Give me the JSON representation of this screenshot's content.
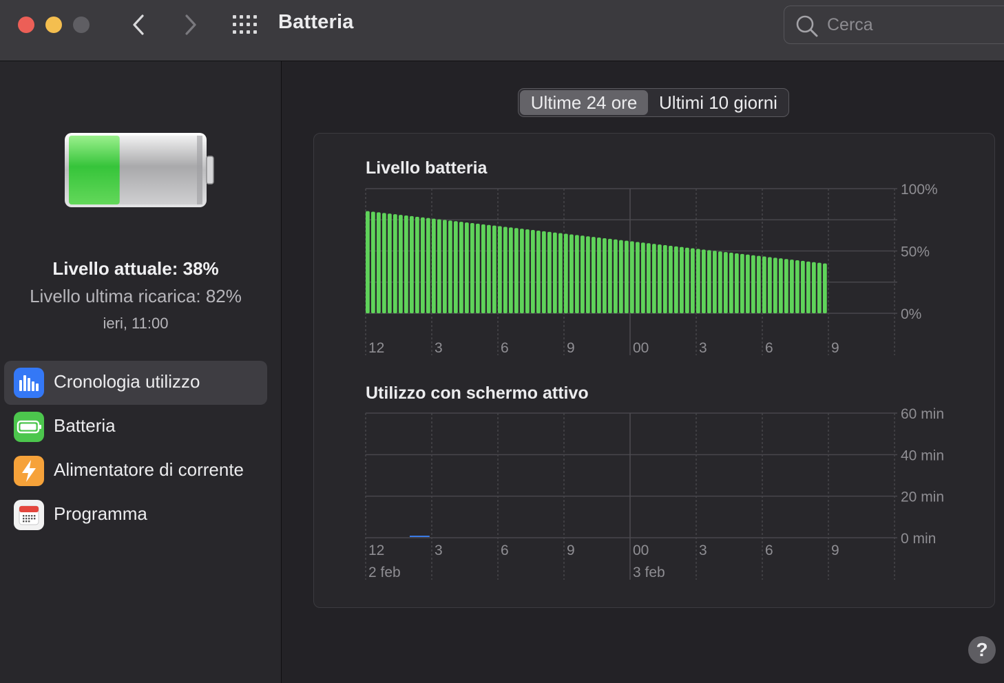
{
  "window": {
    "title": "Batteria",
    "search_placeholder": "Cerca",
    "help_label": "?"
  },
  "sidebar": {
    "current_level": "Livello attuale: 38%",
    "last_charge": "Livello ultima ricarica: 82%",
    "last_charge_time": "ieri, 11:00",
    "items": [
      {
        "label": "Cronologia utilizzo",
        "icon": "bar-chart-icon",
        "color": "#3478f6",
        "active": true
      },
      {
        "label": "Batteria",
        "icon": "battery-icon",
        "color": "#4cc64d",
        "active": false
      },
      {
        "label": "Alimentatore di corrente",
        "icon": "bolt-icon",
        "color": "#f6a23a",
        "active": false
      },
      {
        "label": "Programma",
        "icon": "calendar-icon",
        "color": "#f2f2f2",
        "active": false
      }
    ]
  },
  "segmented": {
    "options": [
      "Ultime 24 ore",
      "Ultimi 10 giorni"
    ],
    "selected": "Ultime 24 ore"
  },
  "colors": {
    "battery_green": "#5fd35a",
    "screen_blue": "#3a7be8"
  },
  "chart_data": [
    {
      "type": "bar",
      "title": "Livello batteria",
      "ylabel": "",
      "y_tick_labels": [
        "100%",
        "50%",
        "0%"
      ],
      "ylim": [
        0,
        100
      ],
      "x_tick_labels": [
        "12",
        "3",
        "6",
        "9",
        "00",
        "3",
        "6",
        "9"
      ],
      "x_tick_hours": [
        12,
        15,
        18,
        21,
        24,
        27,
        30,
        33
      ],
      "xlim_hours": [
        12,
        36
      ],
      "bar_interval_hours": 0.25,
      "bar_start_hour": 12,
      "values_start": 82,
      "values_end": 40,
      "bar_count": 84
    },
    {
      "type": "bar",
      "title": "Utilizzo con schermo attivo",
      "y_tick_labels": [
        "60 min",
        "40 min",
        "20 min",
        "0 min"
      ],
      "ylim": [
        0,
        60
      ],
      "x_tick_labels": [
        "12",
        "3",
        "6",
        "9",
        "00",
        "3",
        "6",
        "9"
      ],
      "x_tick_hours": [
        12,
        15,
        18,
        21,
        24,
        27,
        30,
        33
      ],
      "date_labels": [
        {
          "label": "2 feb",
          "hour": 12
        },
        {
          "label": "3 feb",
          "hour": 24
        }
      ],
      "xlim_hours": [
        12,
        36
      ],
      "values": [
        {
          "hour_start": 14,
          "hour_end": 14.9,
          "minutes": 0.5
        }
      ]
    }
  ]
}
